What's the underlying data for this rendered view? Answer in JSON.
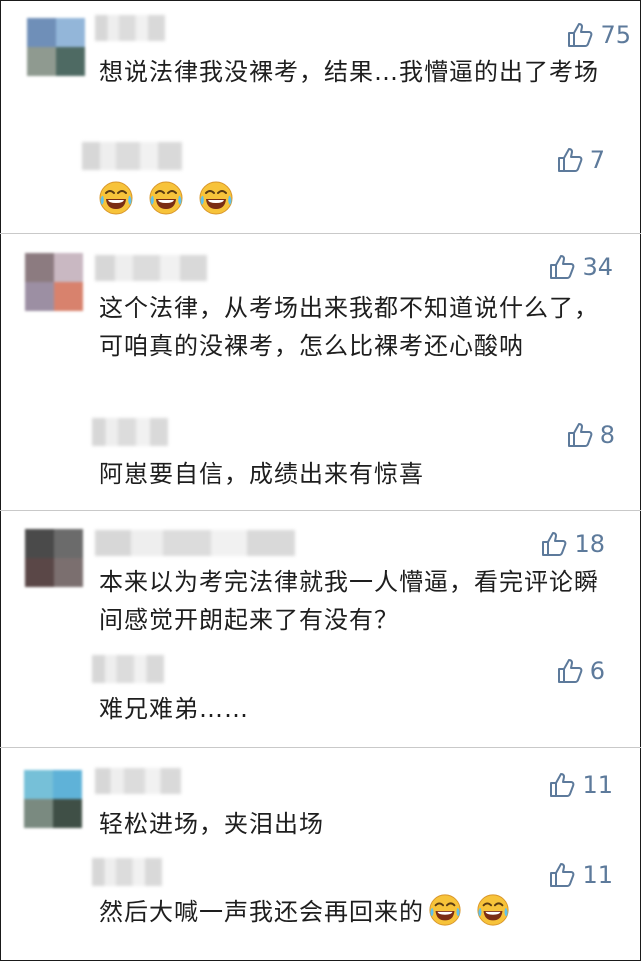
{
  "comments": [
    {
      "likes": "75",
      "text": "想说法律我没裸考，结果…我懵逼的出了考场",
      "avatar_colors": [
        "#6f8fb8",
        "#93b6d9",
        "#8f9a90",
        "#4e6a63"
      ],
      "reply": {
        "likes": "7",
        "text": "",
        "emoji_count": 3,
        "emoji_icon": "laugh-cry-icon"
      }
    },
    {
      "likes": "34",
      "text": "这个法律，从考场出来我都不知道说什么了，可咱真的没裸考，怎么比裸考还心酸呐",
      "avatar_colors": [
        "#8c7b80",
        "#c9b8c2",
        "#9c8fa3",
        "#d8826d"
      ],
      "reply": {
        "likes": "8",
        "text": "阿崽要自信，成绩出来有惊喜"
      }
    },
    {
      "likes": "18",
      "text": "本来以为考完法律就我一人懵逼，看完评论瞬间感觉开朗起来了有没有？",
      "avatar_colors": [
        "#4a4a4a",
        "#6b6b6b",
        "#5a4747",
        "#7b6f6f"
      ],
      "reply": {
        "likes": "6",
        "text": "难兄难弟……"
      }
    },
    {
      "likes": "11",
      "text": "轻松进场，夹泪出场",
      "avatar_colors": [
        "#76c0d8",
        "#5fb2d8",
        "#7a8a80",
        "#3f4f46"
      ],
      "reply": {
        "likes": "11",
        "text": "然后大喊一声我还会再回来的",
        "emoji_count": 2,
        "emoji_icon": "laugh-cry-icon"
      }
    }
  ],
  "colors": {
    "like": "#5d7a9b",
    "text": "#1e1e1e",
    "separator": "#c9c9c9"
  }
}
